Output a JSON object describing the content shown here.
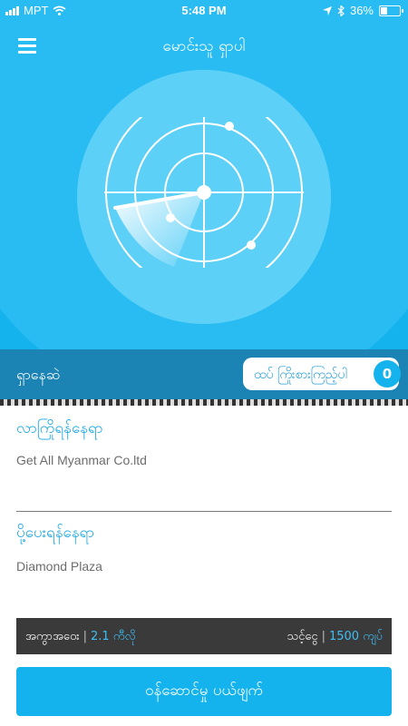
{
  "status_bar": {
    "carrier": "MPT",
    "time": "5:48 PM",
    "battery": "36%",
    "battery_level": 0.36
  },
  "header": {
    "title": "မောင်းသူ ရှာပါ"
  },
  "search": {
    "label": "ရှာနေဆဲ",
    "button_label": "ထပ် ကြိုးစားကြည့်ပါ",
    "count": "0"
  },
  "pickup": {
    "label": "လာကြိုရန်နေရာ",
    "value": "Get All Myanmar Co.ltd"
  },
  "dropoff": {
    "label": "ပို့ပေးရန်နေရာ",
    "value": "Diamond Plaza"
  },
  "trip": {
    "distance_label": "အကွာအဝေး",
    "distance_value": "2.1 ကီလို",
    "fare_label": "သင့်ငွေ",
    "fare_value": "1500 ကျပ်"
  },
  "cta": {
    "label": "ဝန်ဆောင်မှု ပယ်ဖျက်"
  },
  "colors": {
    "primary": "#14b3ee",
    "search_bar": "#1b84b5",
    "info_bar": "#3a3a3a",
    "label_blue": "#1aa6e6"
  }
}
